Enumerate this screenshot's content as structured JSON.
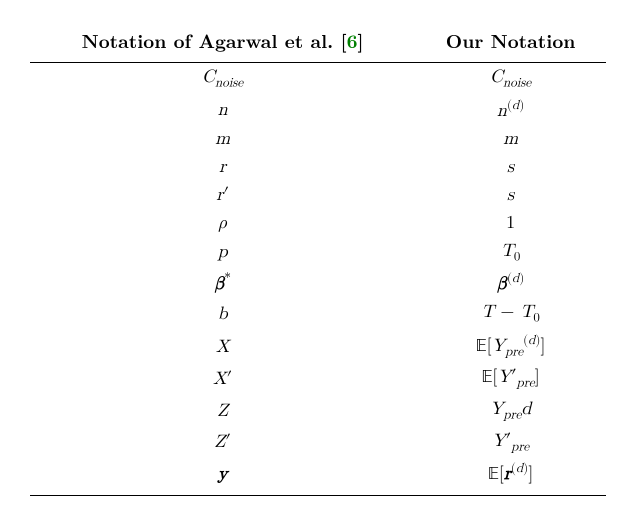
{
  "chart_data": {
    "type": "table",
    "title": "",
    "columns": [
      "Notation of Agarwal et al. [6]",
      "Our Notation"
    ],
    "rows": [
      [
        "C_noise",
        "C_noise"
      ],
      [
        "n",
        "n^(d)"
      ],
      [
        "m",
        "m"
      ],
      [
        "r",
        "s"
      ],
      [
        "r'",
        "s"
      ],
      [
        "ρ",
        "1"
      ],
      [
        "p",
        "T_0"
      ],
      [
        "β*",
        "β^(d)"
      ],
      [
        "b",
        "T − T_0"
      ],
      [
        "X",
        "E[Y_pre^(d)]"
      ],
      [
        "X'",
        "E[Y'_pre]"
      ],
      [
        "Z",
        "Y_pre d"
      ],
      [
        "Z'",
        "Y'_pre"
      ],
      [
        "y",
        "E[r^(d)]"
      ]
    ]
  },
  "header": {
    "col1_prefix": "Notation of Agarwal et al. ",
    "col1_cite_open": "[",
    "col1_cite_num": "6",
    "col1_cite_close": "]",
    "col2": "Our Notation"
  },
  "rows": [
    {
      "left_html": "C<sub>noise</sub>",
      "right_html": "C<sub>noise</sub>"
    },
    {
      "left_html": "n",
      "right_html": "n<sup><span class='rm'>(</span>d<span class='rm'>)</span></sup>"
    },
    {
      "left_html": "m",
      "right_html": "m"
    },
    {
      "left_html": "r",
      "right_html": "s"
    },
    {
      "left_html": "r<span class='rm'>′</span>",
      "right_html": "s"
    },
    {
      "left_html": "ρ",
      "right_html": "<span class='rm'>1</span>"
    },
    {
      "left_html": "p",
      "right_html": "T<sub><span class='rm'>0</span></sub>"
    },
    {
      "left_html": "<b>β</b><sup><span class='rm'>*</span></sup>",
      "right_html": "<b>β</b><sup><span class='rm'>(</span>d<span class='rm'>)</span></sup>"
    },
    {
      "left_html": "b",
      "right_html": "T <span class='rm'>−</span> T<sub><span class='rm'>0</span></sub>"
    },
    {
      "left_html": "X",
      "right_html": "<span class='bb'>𝔼</span><span class='rm'>[</span>Y<sub>pre</sub><sup><span class='rm'>(</span>d<span class='rm'>)</span></sup><span class='rm'>]</span>"
    },
    {
      "left_html": "X<span class='rm'>′</span>",
      "right_html": "<span class='bb'>𝔼</span><span class='rm'>[</span>Y<span class='rm'>′</span><sub>pre</sub><span class='rm'>]</span>"
    },
    {
      "left_html": "Z",
      "right_html": "Y<sub>pre</sub>d"
    },
    {
      "left_html": "Z<span class='rm'>′</span>",
      "right_html": "Y<span class='rm'>′</span><sub>pre</sub>"
    },
    {
      "left_html": "<b>y</b>",
      "right_html": "<span class='bb'>𝔼</span><span class='rm'>[</span><b>r</b><sup><span class='rm'>(</span>d<span class='rm'>)</span></sup><span class='rm'>]</span>"
    }
  ]
}
